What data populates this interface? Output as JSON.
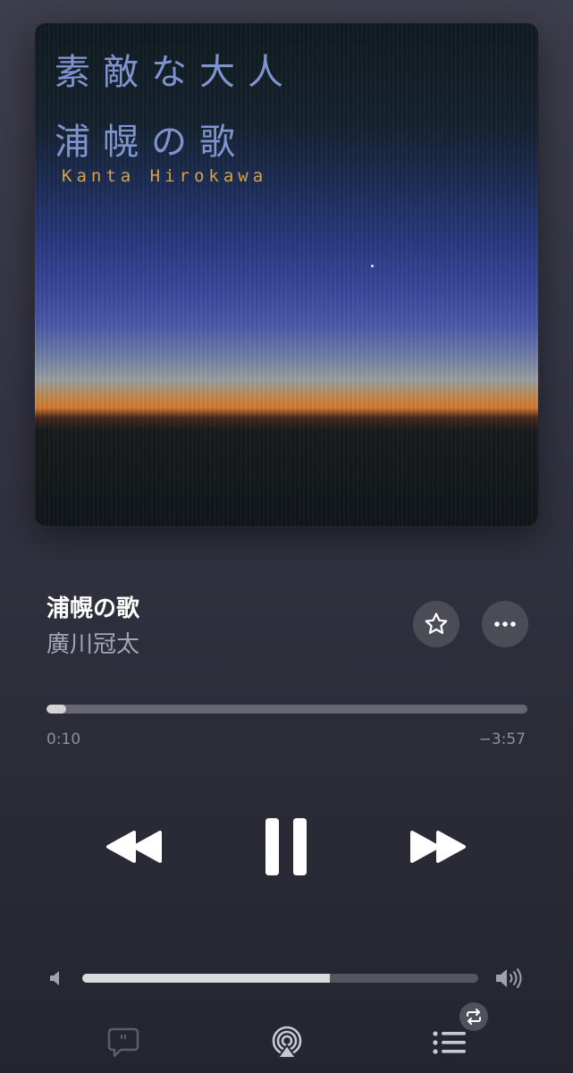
{
  "artwork": {
    "title_line1": "素敵な大人",
    "title_line2": "浦幌の歌",
    "artist_text": "Kanta Hirokawa",
    "title_color": "#7f93cf",
    "artist_color": "#d3a34a"
  },
  "track": {
    "title": "浦幌の歌",
    "artist": "廣川冠太"
  },
  "actions": {
    "favorite_icon": "star-outline-icon",
    "more_icon": "ellipsis-icon"
  },
  "playback": {
    "elapsed": "0:10",
    "remaining": "−3:57",
    "progress_fraction": 0.04,
    "state": "playing"
  },
  "controls": {
    "rewind_icon": "rewind-icon",
    "pause_icon": "pause-icon",
    "forward_icon": "fast-forward-icon"
  },
  "volume": {
    "level_fraction": 0.625,
    "low_icon": "speaker-low-icon",
    "high_icon": "speaker-high-icon"
  },
  "bottom_bar": {
    "lyrics_icon": "lyrics-bubble-icon",
    "airplay_icon": "airplay-icon",
    "queue_icon": "queue-list-icon",
    "repeat_icon": "repeat-icon",
    "repeat_active": true
  }
}
